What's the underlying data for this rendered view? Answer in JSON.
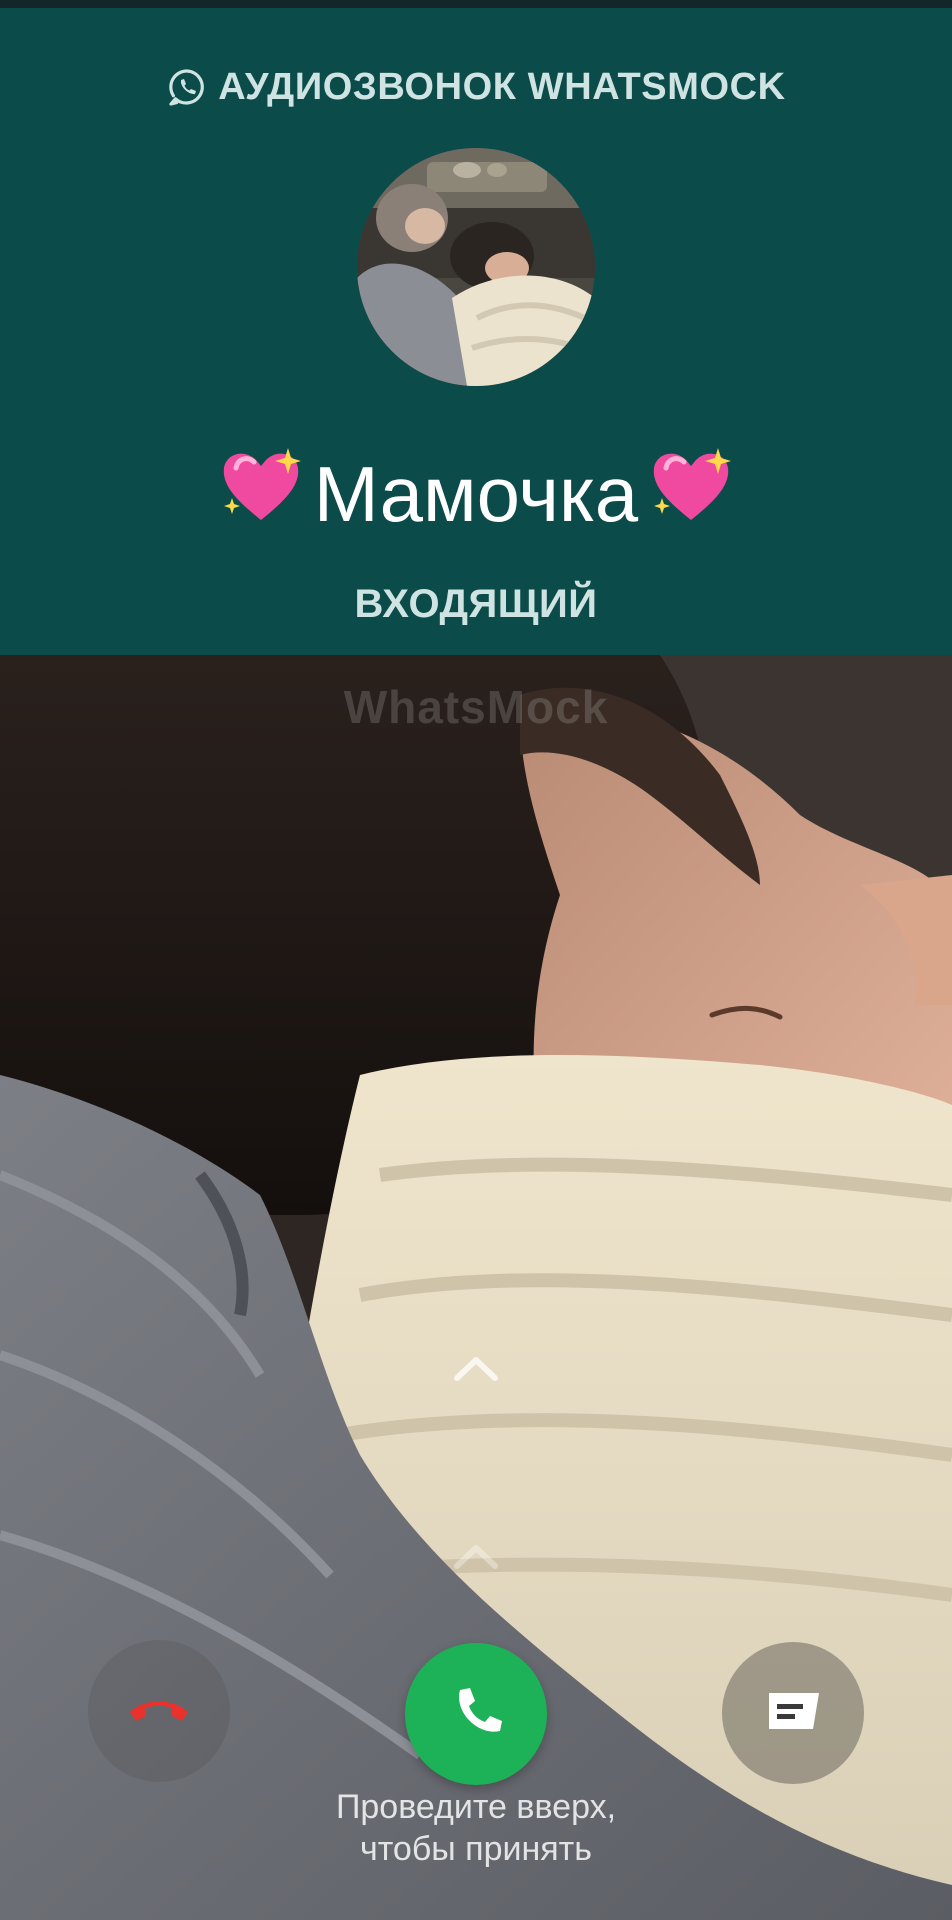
{
  "header": {
    "app_title": "АУДИОЗВОНОК WHATSMOCK",
    "caller_name": "Мамочка",
    "call_status": "ВХОДЯЩИЙ"
  },
  "background": {
    "watermark": "WhatsMock"
  },
  "actions": {
    "decline_icon": "phone-hangup-icon",
    "accept_icon": "phone-icon",
    "message_icon": "message-icon",
    "swipe_hint_line1": "Проведите вверх,",
    "swipe_hint_line2": "чтобы принять"
  },
  "colors": {
    "header_bg": "#0b4c4a",
    "accept": "#1eb258",
    "decline": "#e8322b"
  }
}
